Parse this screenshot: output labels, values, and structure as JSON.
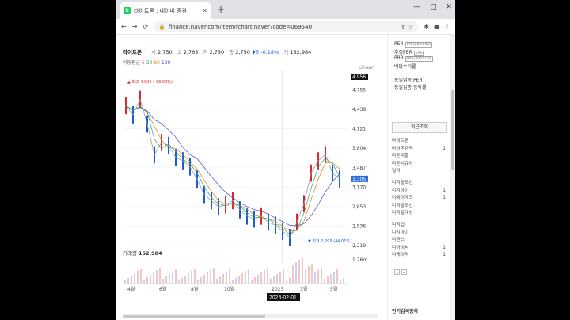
{
  "browser": {
    "tab_title": "라이트론 : 네이버 증권",
    "tab_favicon": "N",
    "url": "finance.naver.com/item/fchart.naver?code=069540"
  },
  "stock": {
    "name": "라이트론",
    "open_label": "시",
    "open": "2,750",
    "high_label": "고",
    "high": "2,765",
    "low_label": "저",
    "low": "2,730",
    "close_label": "종",
    "close": "2,750",
    "change": "▼5",
    "change_pct": "-0.18%",
    "volume_label": "거",
    "volume": "152,984"
  },
  "moving_avg": {
    "label": "이동평균",
    "p5": "5",
    "p20": "20",
    "p60": "60",
    "p120": "120"
  },
  "chart": {
    "scale_label": "Linear",
    "volume_title": "거래량",
    "volume_value": "152,984",
    "volume_axis": "1.26m"
  },
  "chart_data": {
    "type": "line",
    "title": "",
    "y_ticks": [
      "4,755",
      "4,438",
      "4,121",
      "3,804",
      "3,487",
      "3,170",
      "2,853",
      "2,536",
      "2,219"
    ],
    "x_ticks": [
      "4월",
      "6월",
      "8월",
      "10월",
      "2023",
      "3월",
      "5월"
    ],
    "high_marker": "최고 4,900 (-33.00%)",
    "low_marker": "최저 2,295 (44.01%)",
    "last_price_tag": "3,305",
    "top_price_tag": "4,956",
    "crosshair_date": "2023-02-01",
    "ylim": [
      2219,
      4956
    ],
    "series": [
      {
        "values": [
          4500,
          4350,
          4600,
          4200,
          3700,
          3900,
          3850,
          3650,
          3600,
          3500,
          3300,
          3050,
          2950,
          2850,
          2880,
          2950,
          2800,
          2700,
          2650,
          2700,
          2600,
          2550,
          2450,
          2350,
          2600,
          2900,
          3400,
          3600,
          3700,
          3400,
          3305
        ]
      }
    ]
  },
  "side": {
    "per_label": "PER",
    "per_box": "EPS(2023.03)",
    "est_label": "추정PER",
    "est_box": "EPS",
    "pbr_label": "PBR",
    "pbr_box": "BPS(2023.03)",
    "div_label": "배당수익률",
    "same_per": "동일업종 PER",
    "same_rate": "동일업종 등락률",
    "recent_title": "최근조회",
    "recent": [
      {
        "n": "라이트론",
        "v": ""
      },
      {
        "n": "라이온켐텍",
        "v": "1"
      },
      {
        "n": "라온피플",
        "v": ""
      },
      {
        "n": "라온시큐어",
        "v": ""
      },
      {
        "n": "딜리",
        "v": ""
      },
      {
        "n": "디지틀조선",
        "v": ""
      },
      {
        "n": "디지아이",
        "v": "1"
      },
      {
        "n": "디에이테크",
        "v": "1"
      },
      {
        "n": "디지틀조선",
        "v": ""
      },
      {
        "n": "디지털대성",
        "v": ""
      },
      {
        "n": "디지캡",
        "v": ""
      },
      {
        "n": "디지아이",
        "v": ""
      },
      {
        "n": "디젠스",
        "v": ""
      },
      {
        "n": "디아이씨",
        "v": "1"
      },
      {
        "n": "디케이락",
        "v": "1"
      }
    ],
    "popular_title": "인기검색종목"
  },
  "colors": {
    "up": "#e0262c",
    "down": "#1a5cd7",
    "accent_tag": "#2b6cd8"
  }
}
